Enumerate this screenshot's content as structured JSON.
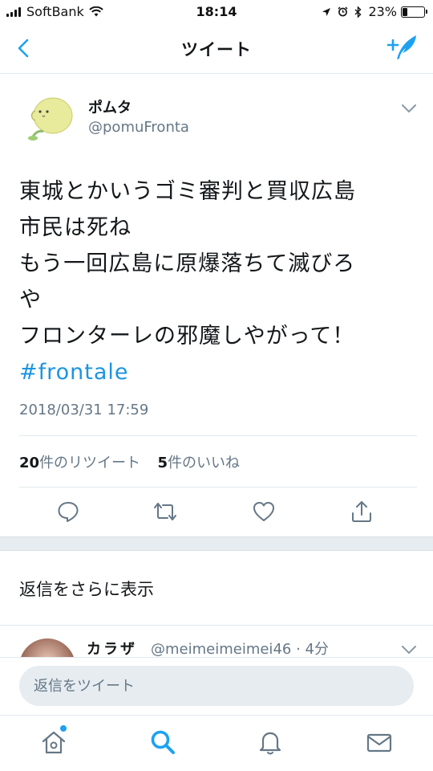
{
  "status_bar": {
    "carrier": "SoftBank",
    "time": "18:14",
    "battery_percent": "23%",
    "battery_level": 0.23
  },
  "nav": {
    "title": "ツイート",
    "back_icon": "chevron-left-icon",
    "compose_icon": "compose-tweet-icon"
  },
  "tweet": {
    "author_name": "ポムタ",
    "author_handle": "@pomuFronta",
    "text_lines": [
      "東城とかいうゴミ審判と買収広島",
      "市民は死ね",
      "もう一回広島に原爆落ちて滅びろ",
      "や",
      "フロンターレの邪魔しやがって！"
    ],
    "hashtag": "#frontale",
    "timestamp": "2018/03/31 17:59",
    "retweet_count": "20",
    "retweet_label": "件のリツイート",
    "like_count": "5",
    "like_label": "件のいいね"
  },
  "more_replies": "返信をさらに表示",
  "reply": {
    "name": "カラザ",
    "meta": "@meimeimeimei46 · 4分"
  },
  "composer": {
    "placeholder": "返信をツイート"
  },
  "colors": {
    "accent": "#1da1f2",
    "hashtag": "#1b95e0",
    "secondary_text": "#657786",
    "divider": "#e1e8ed"
  },
  "tabs": [
    "home-icon",
    "search-icon",
    "notifications-icon",
    "messages-icon"
  ]
}
